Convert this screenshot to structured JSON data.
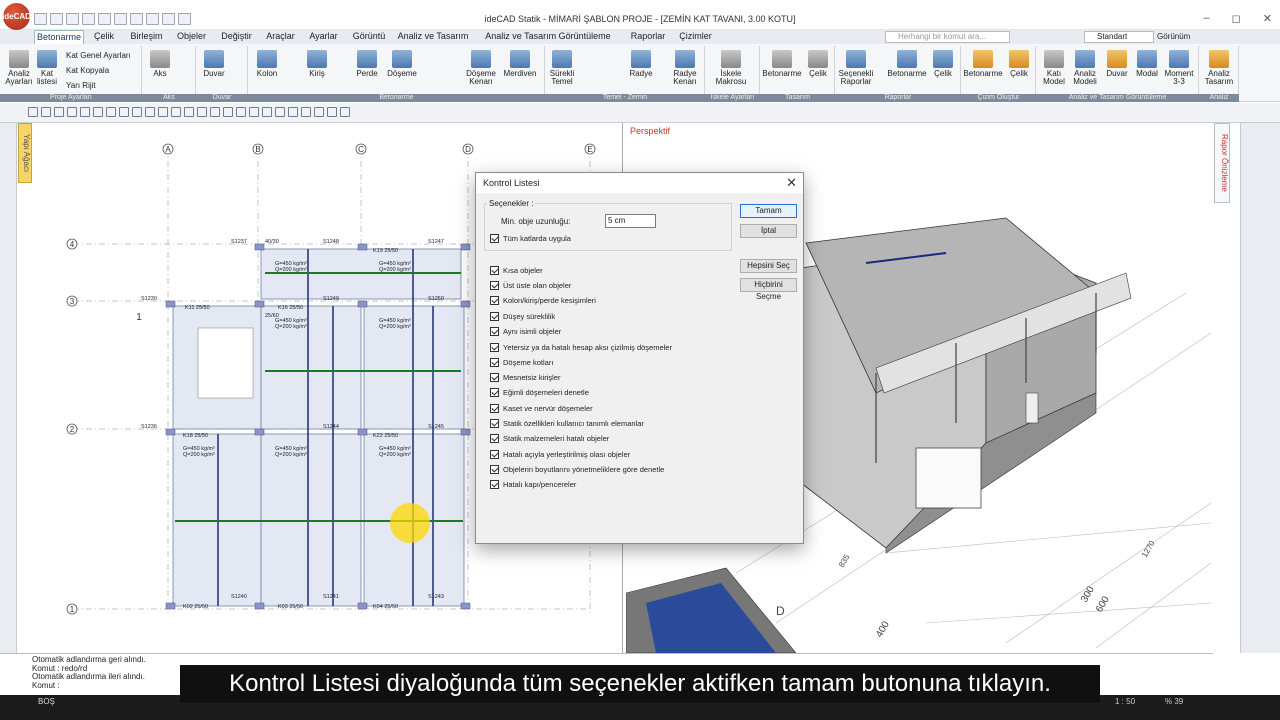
{
  "app": {
    "logo_text": "ideCAD",
    "title": "ideCAD Statik - MİMARİ ŞABLON PROJE - [ZEMİN KAT TAVANI,  3.00 KOTU]",
    "window_buttons": [
      "–",
      "◻",
      "✕"
    ]
  },
  "menu": {
    "items": [
      "Betonarme",
      "Çelik",
      "Birleşim",
      "Objeler",
      "Değiştir",
      "Araçlar",
      "Ayarlar",
      "Görüntü",
      "Analiz ve Tasarım",
      "Analiz ve Tasarım Görüntüleme",
      "Raporlar",
      "Çizimler"
    ],
    "active_index": 0,
    "search_placeholder": "Herhangi bir komut ara...",
    "style_select": "Standart",
    "view_label": "Görünüm"
  },
  "ribbon": {
    "buttons": {
      "analiz_ayarlari": "Analiz Ayarları",
      "kat_listesi": "Kat listesi",
      "kat_genel_ayarlari": "Kat Genel Ayarları",
      "kat_kopyala": "Kat Kopyala",
      "yari_rijit": "Yarı Rijit",
      "aks": "Aks",
      "duvar": "Duvar",
      "kolon": "Kolon",
      "kiris": "Kiriş",
      "perde": "Perde",
      "doseme": "Döşeme",
      "doseme_kenari": "Döşeme Kenarı",
      "merdiven": "Merdiven",
      "surekli_temel": "Sürekli Temel",
      "radye": "Radye",
      "radye_kenari": "Radye Kenarı",
      "iskele_makrosu": "İskele Makrosu",
      "betonarme_t": "Betonarme",
      "celik_t": "Çelik",
      "secenekli_raporlar": "Seçenekli Raporlar",
      "betonarme_r": "Betonarme",
      "celik_r": "Çelik",
      "betonarme_c": "Betonarme",
      "celik_c": "Çelik",
      "kati_model": "Katı Model",
      "analiz_modeli": "Analiz Modeli",
      "duvar_g": "Duvar",
      "modal": "Modal",
      "moment": "Moment 3-3",
      "analiz_tasarim": "Analiz Tasarım"
    },
    "groups": [
      "Proje Ayarları",
      "Aks",
      "Duvar",
      "Betonarme",
      "Temel - Zemin",
      "İskele Ayarları",
      "Tasarım",
      "Raporlar",
      "Çizim Oluştur",
      "Analiz ve Tasarım Görüntüleme",
      "Analiz"
    ]
  },
  "side": {
    "left_tab": "Yapı Ağacı",
    "right_tab": "Rapor Önizleme"
  },
  "plan": {
    "axes_x": [
      "A",
      "B",
      "C",
      "D",
      "E"
    ],
    "axes_y": [
      "4",
      "3",
      "2",
      "1"
    ],
    "section_mark": "1",
    "slab_g": "G=450 kg/m²",
    "slab_q": "Q=200 kg/m²",
    "beam_labels": [
      "K16 25/50",
      "K19 25/50",
      "K11 25/50",
      "K18 25/50",
      "K22 25/50",
      "K02 25/50",
      "K03 25/50",
      "K04 25/50"
    ],
    "column_labels": [
      "S1237",
      "S1248",
      "S1247",
      "S1230",
      "S1249",
      "S1250",
      "S1236",
      "S1244",
      "S1245",
      "S1240",
      "S1241",
      "S1243",
      "40/30",
      "25/60"
    ]
  },
  "perspective": {
    "title": "Perspektif",
    "dims": [
      "400",
      "300",
      "600",
      "835",
      "1270",
      "D"
    ]
  },
  "dialog": {
    "title": "Kontrol Listesi",
    "section_label": "Seçenekler :",
    "min_length_label": "Min. obje uzunluğu:",
    "min_length_value": "5 cm",
    "all_floors_label": "Tüm katlarda uygula",
    "all_floors_checked": true,
    "buttons": {
      "ok": "Tamam",
      "cancel": "İptal",
      "select_all": "Hepsini Seç",
      "select_none": "Hiçbirini Seçme"
    },
    "checks": [
      {
        "label": "Kısa objeler",
        "checked": true
      },
      {
        "label": "Üst üste olan objeler",
        "checked": true
      },
      {
        "label": "Kolon/kiriş/perde kesişimleri",
        "checked": true
      },
      {
        "label": "Düşey süreklilik",
        "checked": true
      },
      {
        "label": "Aynı isimli objeler",
        "checked": true
      },
      {
        "label": "Yetersiz ya da hatalı hesap aksı çizilmiş döşemeler",
        "checked": true
      },
      {
        "label": "Döşeme kotları",
        "checked": true
      },
      {
        "label": "Mesnetsiz kirişler",
        "checked": true
      },
      {
        "label": "Eğimli döşemeleri denetle",
        "checked": true
      },
      {
        "label": "Kaset ve nervür döşemeler",
        "checked": true
      },
      {
        "label": "Statik özellikleri kullanıcı tanımlı elemanlar",
        "checked": true
      },
      {
        "label": "Statik malzemeleri hatalı objeler",
        "checked": true
      },
      {
        "label": "Hatalı açıyla yerleştirilmiş olası objeler",
        "checked": true
      },
      {
        "label": "Objelerin boyutlarını yönetmeliklere göre denetle",
        "checked": true
      },
      {
        "label": "Hatalı kapı/pencereler",
        "checked": true
      }
    ]
  },
  "command": {
    "lines": [
      "Otomatik adlandırma geri alındı.",
      "Komut : redo/rd",
      "Otomatik adlandırma ileri alındı.",
      "Komut :"
    ]
  },
  "status": {
    "left": "BOŞ",
    "scale": "1 : 50",
    "zoom": "% 39"
  },
  "caption": "Kontrol Listesi diyaloğunda tüm seçenekler aktifken tamam butonuna tıklayın."
}
